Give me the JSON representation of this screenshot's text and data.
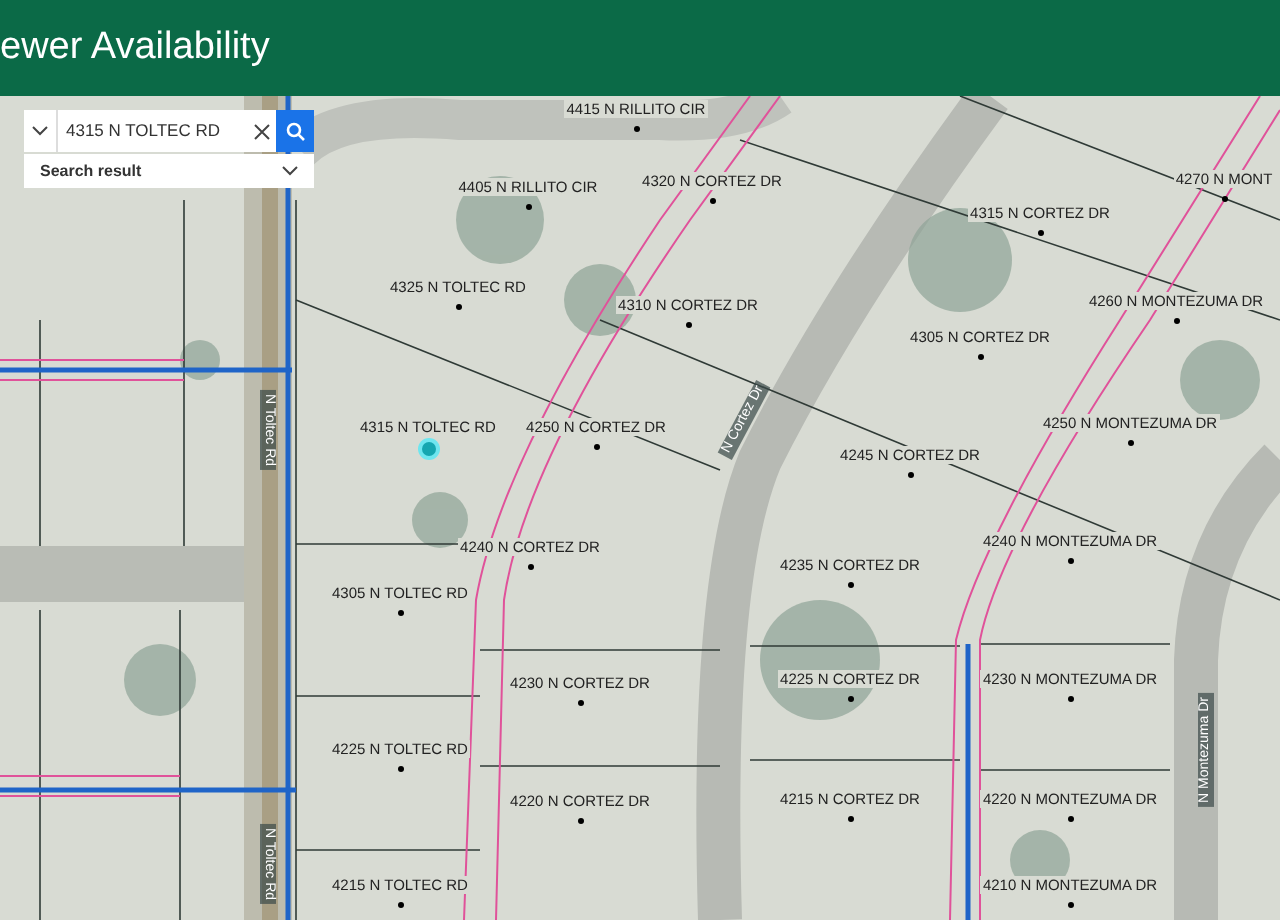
{
  "header": {
    "title": "ewer Availability"
  },
  "search": {
    "value": "4315 N TOLTEC RD",
    "result_label": "Search result"
  },
  "map": {
    "parcels": [
      {
        "label": "4415 N RILLITO CIR",
        "selected": false
      },
      {
        "label": "4405 N RILLITO CIR",
        "selected": false
      },
      {
        "label": "4320 N CORTEZ DR",
        "selected": false
      },
      {
        "label": "4325 N TOLTEC RD",
        "selected": false
      },
      {
        "label": "4310 N CORTEZ DR",
        "selected": false
      },
      {
        "label": "4315 N TOLTEC RD",
        "selected": true
      },
      {
        "label": "4250 N CORTEZ DR",
        "selected": false
      },
      {
        "label": "4315 N CORTEZ DR",
        "selected": false
      },
      {
        "label": "4305 N CORTEZ DR",
        "selected": false
      },
      {
        "label": "4270 N MONT",
        "selected": false
      },
      {
        "label": "4260 N MONTEZUMA DR",
        "selected": false
      },
      {
        "label": "4250 N MONTEZUMA DR",
        "selected": false
      },
      {
        "label": "4245 N CORTEZ DR",
        "selected": false
      },
      {
        "label": "4240 N CORTEZ DR",
        "selected": false
      },
      {
        "label": "4240 N MONTEZUMA DR",
        "selected": false
      },
      {
        "label": "4235 N CORTEZ DR",
        "selected": false
      },
      {
        "label": "4305 N TOLTEC RD",
        "selected": false
      },
      {
        "label": "4230 N CORTEZ DR",
        "selected": false
      },
      {
        "label": "4225 N CORTEZ DR",
        "selected": false
      },
      {
        "label": "4230 N MONTEZUMA DR",
        "selected": false
      },
      {
        "label": "4225 N TOLTEC RD",
        "selected": false
      },
      {
        "label": "4220 N CORTEZ DR",
        "selected": false
      },
      {
        "label": "4215 N CORTEZ DR",
        "selected": false
      },
      {
        "label": "4220 N MONTEZUMA DR",
        "selected": false
      },
      {
        "label": "4215 N TOLTEC RD",
        "selected": false
      },
      {
        "label": "4210 N MONTEZUMA DR",
        "selected": false
      }
    ],
    "streets": [
      "N Toltec Rd",
      "N Toltec Rd",
      "N Cortez Dr",
      "N Montezuma Dr"
    ]
  }
}
